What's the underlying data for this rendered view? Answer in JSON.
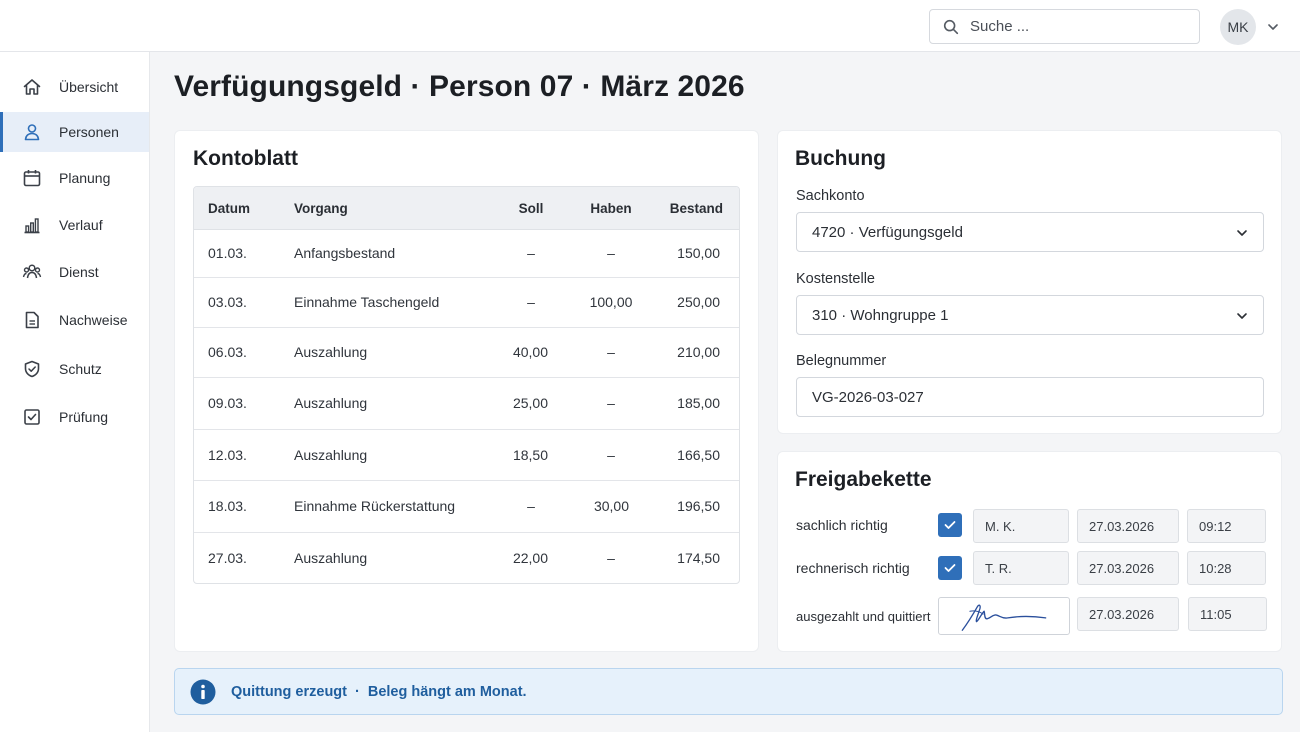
{
  "header": {
    "search_placeholder": "Suche ...",
    "user_initials": "MK"
  },
  "sidebar": {
    "items": [
      {
        "label": "Übersicht",
        "icon": "home-icon"
      },
      {
        "label": "Personen",
        "icon": "person-icon",
        "active": true
      },
      {
        "label": "Planung",
        "icon": "calendar-icon"
      },
      {
        "label": "Verlauf",
        "icon": "bar-chart-icon"
      },
      {
        "label": "Dienst",
        "icon": "group-icon"
      },
      {
        "label": "Nachweise",
        "icon": "document-icon"
      },
      {
        "label": "Schutz",
        "icon": "shield-icon"
      },
      {
        "label": "Prüfung",
        "icon": "checkbox-icon"
      }
    ]
  },
  "page": {
    "title": "Verfügungsgeld · Person 07 · März 2026"
  },
  "kontoblatt": {
    "title": "Kontoblatt",
    "columns": [
      "Datum",
      "Vorgang",
      "Soll",
      "Haben",
      "Bestand"
    ],
    "rows": [
      [
        "01.03.",
        "Anfangsbestand",
        "–",
        "–",
        "150,00"
      ],
      [
        "03.03.",
        "Einnahme Taschengeld",
        "–",
        "100,00",
        "250,00"
      ],
      [
        "06.03.",
        "Auszahlung",
        "40,00",
        "–",
        "210,00"
      ],
      [
        "09.03.",
        "Auszahlung",
        "25,00",
        "–",
        "185,00"
      ],
      [
        "12.03.",
        "Auszahlung",
        "18,50",
        "–",
        "166,50"
      ],
      [
        "18.03.",
        "Einnahme Rückerstattung",
        "–",
        "30,00",
        "196,50"
      ],
      [
        "27.03.",
        "Auszahlung",
        "22,00",
        "–",
        "174,50"
      ]
    ]
  },
  "buchung": {
    "title": "Buchung",
    "sachkonto_label": "Sachkonto",
    "sachkonto_value": "4720 · Verfügungsgeld",
    "kostenstelle_label": "Kostenstelle",
    "kostenstelle_value": "310 · Wohngruppe 1",
    "belegnummer_label": "Belegnummer",
    "belegnummer_value": "VG-2026-03-027"
  },
  "freigabe": {
    "title": "Freigabekette",
    "steps": [
      {
        "label": "sachlich richtig",
        "checked": true,
        "initials": "M. K.",
        "date": "27.03.2026",
        "time": "09:12"
      },
      {
        "label": "rechnerisch richtig",
        "checked": true,
        "initials": "T. R.",
        "date": "27.03.2026",
        "time": "10:28"
      },
      {
        "label": "ausgezahlt und quittiert",
        "signature": true,
        "date": "27.03.2026",
        "time": "11:05"
      }
    ]
  },
  "banner": {
    "part1": "Quittung erzeugt",
    "part2": "Beleg hängt am Monat."
  },
  "colors": {
    "accent": "#2f6fb9",
    "banner_bg": "#e6f1fb",
    "banner_text": "#1f5e9e"
  }
}
